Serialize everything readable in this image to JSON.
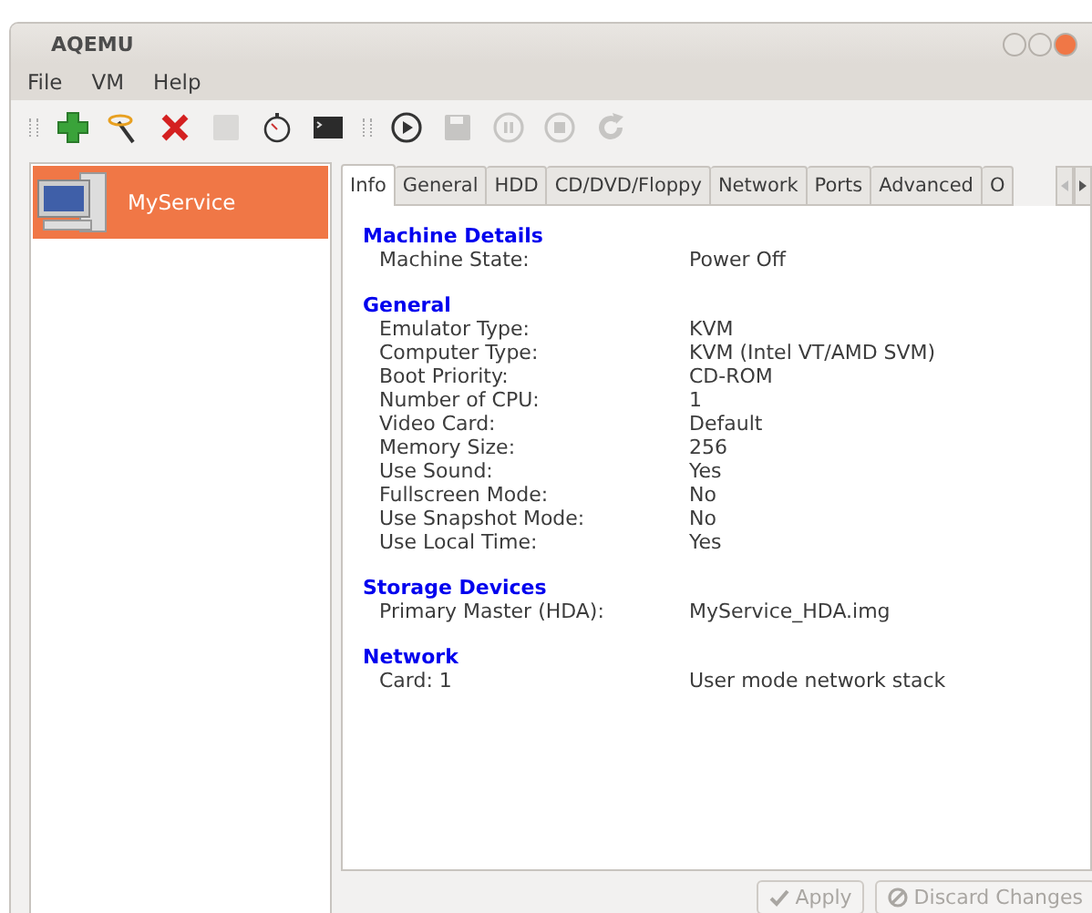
{
  "window": {
    "title": "AQEMU"
  },
  "menu": [
    {
      "label": "File"
    },
    {
      "label": "VM"
    },
    {
      "label": "Help"
    }
  ],
  "toolbar": [
    [
      {
        "kind": "add",
        "disabled": false
      },
      {
        "kind": "wizard",
        "disabled": false
      },
      {
        "kind": "delete",
        "disabled": false
      },
      {
        "kind": "drive",
        "disabled": true
      },
      {
        "kind": "timer",
        "disabled": false
      },
      {
        "kind": "terminal",
        "disabled": false
      }
    ],
    [
      {
        "kind": "play",
        "disabled": false
      },
      {
        "kind": "save",
        "disabled": true
      },
      {
        "kind": "pause",
        "disabled": true
      },
      {
        "kind": "stop",
        "disabled": true
      },
      {
        "kind": "reload",
        "disabled": true
      }
    ]
  ],
  "sidebar": {
    "items": [
      {
        "label": "MyService",
        "selected": true
      }
    ]
  },
  "tabs": [
    {
      "label": "Info",
      "selected": true
    },
    {
      "label": "General",
      "selected": false
    },
    {
      "label": "HDD",
      "selected": false
    },
    {
      "label": "CD/DVD/Floppy",
      "selected": false
    },
    {
      "label": "Network",
      "selected": false
    },
    {
      "label": "Ports",
      "selected": false
    },
    {
      "label": "Advanced",
      "selected": false
    },
    {
      "label": "O",
      "selected": false
    }
  ],
  "tab_scroll": {
    "left_disabled": true,
    "right_disabled": false
  },
  "sections": [
    {
      "title": "Machine Details",
      "rows": [
        {
          "label": "Machine State:",
          "value": "Power Off"
        }
      ]
    },
    {
      "title": "General",
      "rows": [
        {
          "label": "Emulator Type:",
          "value": "KVM"
        },
        {
          "label": "Computer Type:",
          "value": "KVM (Intel VT/AMD SVM)"
        },
        {
          "label": "Boot Priority:",
          "value": "CD-ROM"
        },
        {
          "label": "Number of CPU:",
          "value": "1"
        },
        {
          "label": "Video Card:",
          "value": "Default"
        },
        {
          "label": "Memory Size:",
          "value": "256"
        },
        {
          "label": "Use Sound:",
          "value": "Yes"
        },
        {
          "label": "Fullscreen Mode:",
          "value": "No"
        },
        {
          "label": "Use Snapshot Mode:",
          "value": "No"
        },
        {
          "label": "Use Local Time:",
          "value": "Yes"
        }
      ]
    },
    {
      "title": "Storage Devices",
      "rows": [
        {
          "label": "Primary Master (HDA):",
          "value": "MyService_HDA.img"
        }
      ]
    },
    {
      "title": "Network",
      "rows": [
        {
          "label": "Card: 1",
          "value": "User mode network stack"
        }
      ]
    }
  ],
  "buttons": [
    {
      "kind": "apply",
      "label": "Apply",
      "disabled": true
    },
    {
      "kind": "discard",
      "label": "Discard Changes",
      "disabled": true
    }
  ]
}
